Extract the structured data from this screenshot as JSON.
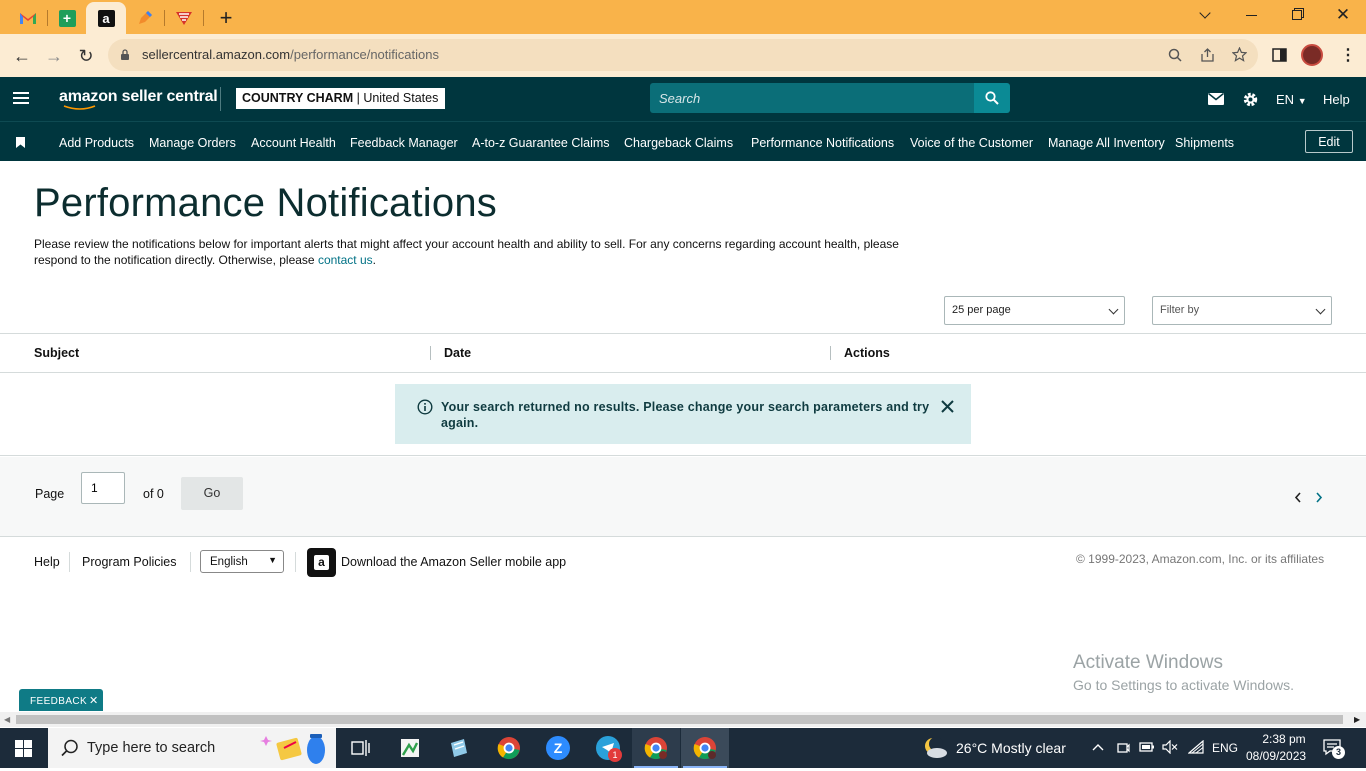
{
  "browser": {
    "url_host": "sellercentral.amazon.com",
    "url_path": "/performance/notifications",
    "window_controls": [
      "chevron-down",
      "minimize",
      "restore",
      "close"
    ]
  },
  "header": {
    "logo_text": "amazon seller central",
    "account_name": "COUNTRY CHARM",
    "account_region": "United States",
    "search_placeholder": "Search",
    "language": "EN",
    "help": "Help"
  },
  "nav": {
    "items": [
      "Add Products",
      "Manage Orders",
      "Account Health",
      "Feedback Manager",
      "A-to-z Guarantee Claims",
      "Chargeback Claims",
      "Performance Notifications",
      "Voice of the Customer",
      "Manage All Inventory",
      "Shipments"
    ],
    "edit": "Edit"
  },
  "page": {
    "title": "Performance Notifications",
    "intro": "Please review the notifications below for important alerts that might affect your account health and ability to sell. For any concerns regarding account health, please respond to the notification directly. Otherwise, please ",
    "contact_link": "contact us",
    "intro_end": ".",
    "per_page": "25 per page",
    "filter_placeholder": "Filter by"
  },
  "table": {
    "columns": [
      "Subject",
      "Date",
      "Actions"
    ],
    "alert": "Your search returned no results. Please change your search parameters and try again."
  },
  "pager": {
    "page_label": "Page",
    "page_value": "1",
    "of_label": "of 0",
    "go": "Go"
  },
  "footer": {
    "help": "Help",
    "program_policies": "Program Policies",
    "language_selected": "English",
    "app_text": "Download the Amazon Seller mobile app",
    "copyright": "© 1999-2023, Amazon.com, Inc. or its affiliates"
  },
  "watermark": {
    "line1": "Activate Windows",
    "line2": "Go to Settings to activate Windows."
  },
  "feedback": "FEEDBACK",
  "taskbar": {
    "search_placeholder": "Type here to search",
    "weather": "26°C  Mostly clear",
    "lang": "ENG",
    "time": "2:38 pm",
    "date": "08/09/2023",
    "notifications": "3",
    "telegram_badge": "1"
  },
  "colors": {
    "tabstrip": "#f9b34a",
    "header": "#00363e",
    "accent": "#007185"
  }
}
